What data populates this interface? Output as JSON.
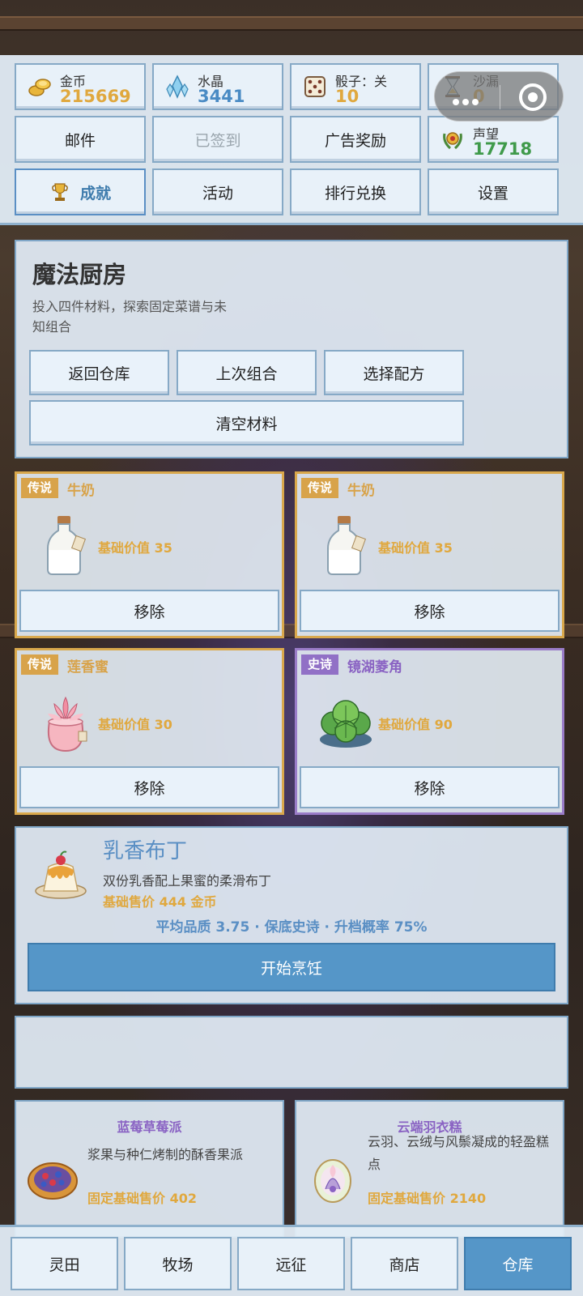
{
  "resources": {
    "gold": {
      "label": "金币",
      "value": "215669",
      "color": "#e0a83e"
    },
    "crystal": {
      "label": "水晶",
      "value": "3441",
      "color": "#4a8bc4"
    },
    "dice": {
      "label": "骰子：关",
      "value": "10",
      "color": "#e0a83e"
    },
    "hourglass": {
      "label": "沙漏",
      "value": "0",
      "color": "#e0a83e"
    },
    "reputation": {
      "label": "声望",
      "value": "17718",
      "color": "#3f9a4a"
    }
  },
  "menu": {
    "mail": "邮件",
    "signed_in": "已签到",
    "ad_reward": "广告奖励",
    "achievement": "成就",
    "activity": "活动",
    "ranking_exchange": "排行兑换",
    "settings": "设置"
  },
  "kitchen": {
    "title": "魔法厨房",
    "description": "投入四件材料，探索固定菜谱与未知组合",
    "buttons": {
      "back": "返回仓库",
      "last_combo": "上次组合",
      "choose_recipe": "选择配方",
      "clear": "清空材料"
    }
  },
  "ingredients": [
    {
      "rarity": "传说",
      "name": "牛奶",
      "value": "基础价值 35",
      "remove": "移除",
      "icon": "milk-bottle-icon"
    },
    {
      "rarity": "传说",
      "name": "牛奶",
      "value": "基础价值 35",
      "remove": "移除",
      "icon": "milk-bottle-icon"
    },
    {
      "rarity": "传说",
      "name": "莲香蜜",
      "value": "基础价值 30",
      "remove": "移除",
      "icon": "lotus-honey-jar-icon"
    },
    {
      "rarity": "史诗",
      "name": "镜湖菱角",
      "value": "基础价值 90",
      "remove": "移除",
      "icon": "water-chestnut-plant-icon"
    }
  ],
  "recipe": {
    "name": "乳香布丁",
    "description": "双份乳香配上果蜜的柔滑布丁",
    "price": "基础售价 444 金币",
    "stats": "平均品质 3.75 · 保底史诗 · 升档概率 75%",
    "cook_button": "开始烹饪",
    "icon": "pudding-icon"
  },
  "recipe_cards": [
    {
      "name": "蓝莓草莓派",
      "description": "浆果与种仁烤制的酥香果派",
      "price": "固定基础售价 402",
      "icon": "berry-pie-icon"
    },
    {
      "name": "云端羽衣糕",
      "description": "云羽、云绒与风鬃凝成的轻盈糕点",
      "price": "固定基础售价 2140",
      "icon": "feather-cake-icon"
    }
  ],
  "nav": {
    "tabs": [
      "灵田",
      "牧场",
      "远征",
      "商店",
      "仓库"
    ],
    "active": "仓库"
  }
}
